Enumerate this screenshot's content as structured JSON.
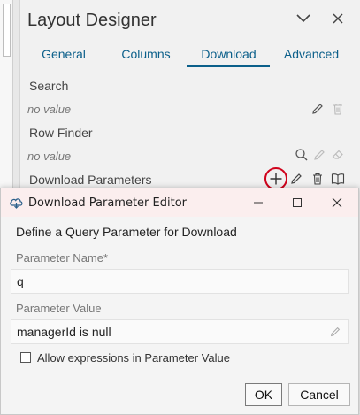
{
  "designer": {
    "title": "Layout Designer",
    "tabs": [
      "General",
      "Columns",
      "Download",
      "Advanced"
    ],
    "active_tab": "Download",
    "search": {
      "label": "Search",
      "value": "no value"
    },
    "row_finder": {
      "label": "Row Finder",
      "value": "no value"
    },
    "download_parameters": {
      "label": "Download Parameters"
    }
  },
  "dialog": {
    "title": "Download Parameter Editor",
    "heading": "Define a Query Parameter for Download",
    "param_name_label": "Parameter Name*",
    "param_name_value": "q",
    "param_value_label": "Parameter Value",
    "param_value_value": "managerId is null",
    "checkbox_label": "Allow expressions in Parameter Value",
    "checkbox_checked": false,
    "ok_label": "OK",
    "cancel_label": "Cancel"
  },
  "colors": {
    "accent": "#0b5f8a",
    "highlight": "#d0021b",
    "titlebar": "#fbeeee"
  }
}
